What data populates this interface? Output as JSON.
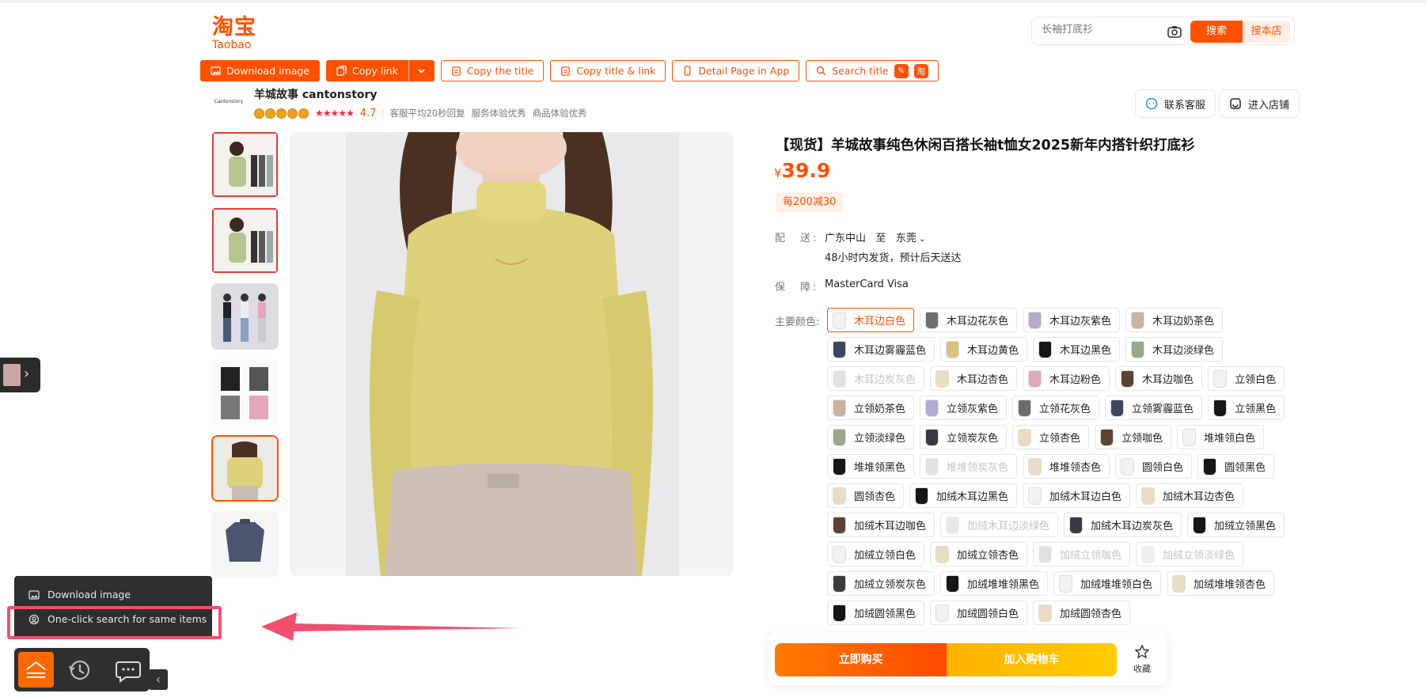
{
  "header": {
    "logo_cn": "淘宝",
    "logo_en": "Taobao",
    "search_placeholder": "长袖打底衫",
    "search_button": "搜索",
    "search_store_button": "搜本店"
  },
  "toolbar": {
    "download_image": "Download image",
    "copy_link": "Copy link",
    "copy_title": "Copy the title",
    "copy_title_link": "Copy title & link",
    "detail_page_app": "Detail Page in App",
    "search_title": "Search title"
  },
  "store": {
    "logo_text": "Cantonstory",
    "name": "羊城故事 cantonstory",
    "rating": "4.7",
    "tags": [
      "客服平均20秒回复",
      "服务体验优秀",
      "商品体验优秀"
    ],
    "contact_button": "联系客服",
    "enter_store_button": "进入店铺"
  },
  "product": {
    "title": "【现货】羊城故事纯色休闲百搭长袖t恤女2025新年内搭针织打底衫",
    "currency": "¥",
    "price": "39.9",
    "promo": "每200减30",
    "shipping_label": "配　送:",
    "ship_from": "广东中山",
    "ship_to_word": "至",
    "ship_to": "东莞",
    "ship_note": "48小时内发货，预计后天送达",
    "guarantee_label": "保　障:",
    "guarantee_value": "MasterCard Visa",
    "color_label": "主要颜色:",
    "buy_now": "立即购买",
    "add_cart": "加入购物车",
    "favorite": "收藏"
  },
  "variants": [
    {
      "label": "木耳边白色",
      "color": "#f2f2f2",
      "selected": true,
      "disabled": false
    },
    {
      "label": "木耳边花灰色",
      "color": "#6d6d6d",
      "selected": false,
      "disabled": false
    },
    {
      "label": "木耳边灰紫色",
      "color": "#b3a9cf",
      "selected": false,
      "disabled": false
    },
    {
      "label": "木耳边奶茶色",
      "color": "#c9b2a0",
      "selected": false,
      "disabled": false
    },
    {
      "label": "木耳边雾霾蓝色",
      "color": "#3f4560",
      "selected": false,
      "disabled": false
    },
    {
      "label": "木耳边黄色",
      "color": "#d9c37a",
      "selected": false,
      "disabled": false
    },
    {
      "label": "木耳边黑色",
      "color": "#161616",
      "selected": false,
      "disabled": false
    },
    {
      "label": "木耳边淡绿色",
      "color": "#9aa88a",
      "selected": false,
      "disabled": false
    },
    {
      "label": "木耳边炭灰色",
      "color": "#bdbdbd",
      "selected": false,
      "disabled": true
    },
    {
      "label": "木耳边杏色",
      "color": "#e8dcc4",
      "selected": false,
      "disabled": false
    },
    {
      "label": "木耳边粉色",
      "color": "#e2a7bd",
      "selected": false,
      "disabled": false
    },
    {
      "label": "木耳边咖色",
      "color": "#5c4334",
      "selected": false,
      "disabled": false
    },
    {
      "label": "立领白色",
      "color": "#f2f2f2",
      "selected": false,
      "disabled": false
    },
    {
      "label": "立领奶茶色",
      "color": "#c9b2a0",
      "selected": false,
      "disabled": false
    },
    {
      "label": "立领灰紫色",
      "color": "#b3a9cf",
      "selected": false,
      "disabled": false
    },
    {
      "label": "立领花灰色",
      "color": "#6d6d6d",
      "selected": false,
      "disabled": false
    },
    {
      "label": "立领雾霾蓝色",
      "color": "#3f4560",
      "selected": false,
      "disabled": false
    },
    {
      "label": "立领黑色",
      "color": "#161616",
      "selected": false,
      "disabled": false
    },
    {
      "label": "立领淡绿色",
      "color": "#9aa88a",
      "selected": false,
      "disabled": false
    },
    {
      "label": "立领炭灰色",
      "color": "#3a3a42",
      "selected": false,
      "disabled": false
    },
    {
      "label": "立领杏色",
      "color": "#e8dcc4",
      "selected": false,
      "disabled": false
    },
    {
      "label": "立领咖色",
      "color": "#5c4334",
      "selected": false,
      "disabled": false
    },
    {
      "label": "堆堆领白色",
      "color": "#f2f2f2",
      "selected": false,
      "disabled": false
    },
    {
      "label": "堆堆领黑色",
      "color": "#161616",
      "selected": false,
      "disabled": false
    },
    {
      "label": "堆堆领炭灰色",
      "color": "#bdbdbd",
      "selected": false,
      "disabled": true
    },
    {
      "label": "堆堆领杏色",
      "color": "#e8dcc4",
      "selected": false,
      "disabled": false
    },
    {
      "label": "圆领白色",
      "color": "#f2f2f2",
      "selected": false,
      "disabled": false
    },
    {
      "label": "圆领黑色",
      "color": "#161616",
      "selected": false,
      "disabled": false
    },
    {
      "label": "圆领杏色",
      "color": "#e8dcc4",
      "selected": false,
      "disabled": false
    },
    {
      "label": "加绒木耳边黑色",
      "color": "#161616",
      "selected": false,
      "disabled": false
    },
    {
      "label": "加绒木耳边白色",
      "color": "#f2f2f2",
      "selected": false,
      "disabled": false
    },
    {
      "label": "加绒木耳边杏色",
      "color": "#e8dcc4",
      "selected": false,
      "disabled": false
    },
    {
      "label": "加绒木耳边咖色",
      "color": "#5c4334",
      "selected": false,
      "disabled": false
    },
    {
      "label": "加绒木耳边淡绿色",
      "color": "#c8cfc0",
      "selected": false,
      "disabled": true
    },
    {
      "label": "加绒木耳边炭灰色",
      "color": "#3a3a42",
      "selected": false,
      "disabled": false
    },
    {
      "label": "加绒立领黑色",
      "color": "#161616",
      "selected": false,
      "disabled": false
    },
    {
      "label": "加绒立领白色",
      "color": "#f2f2f2",
      "selected": false,
      "disabled": false
    },
    {
      "label": "加绒立领杏色",
      "color": "#e8dcc4",
      "selected": false,
      "disabled": false
    },
    {
      "label": "加绒立领咖色",
      "color": "#bdbdbd",
      "selected": false,
      "disabled": true
    },
    {
      "label": "加绒立领淡绿色",
      "color": "#d9ddd3",
      "selected": false,
      "disabled": true
    },
    {
      "label": "加绒立领炭灰色",
      "color": "#3a3a42",
      "selected": false,
      "disabled": false
    },
    {
      "label": "加绒堆堆领黑色",
      "color": "#161616",
      "selected": false,
      "disabled": false
    },
    {
      "label": "加绒堆堆领白色",
      "color": "#f2f2f2",
      "selected": false,
      "disabled": false
    },
    {
      "label": "加绒堆堆领杏色",
      "color": "#e8dcc4",
      "selected": false,
      "disabled": false
    },
    {
      "label": "加绒圆领黑色",
      "color": "#161616",
      "selected": false,
      "disabled": false
    },
    {
      "label": "加绒圆领白色",
      "color": "#f2f2f2",
      "selected": false,
      "disabled": false
    },
    {
      "label": "加绒圆领杏色",
      "color": "#e8dcc4",
      "selected": false,
      "disabled": false
    }
  ],
  "widget": {
    "popup_download": "Download image",
    "popup_search_same": "One-click search for same items"
  },
  "colors": {
    "accent": "#ff5000",
    "highlight_box": "#f0506e",
    "product_yellow": "#ddd27a"
  }
}
